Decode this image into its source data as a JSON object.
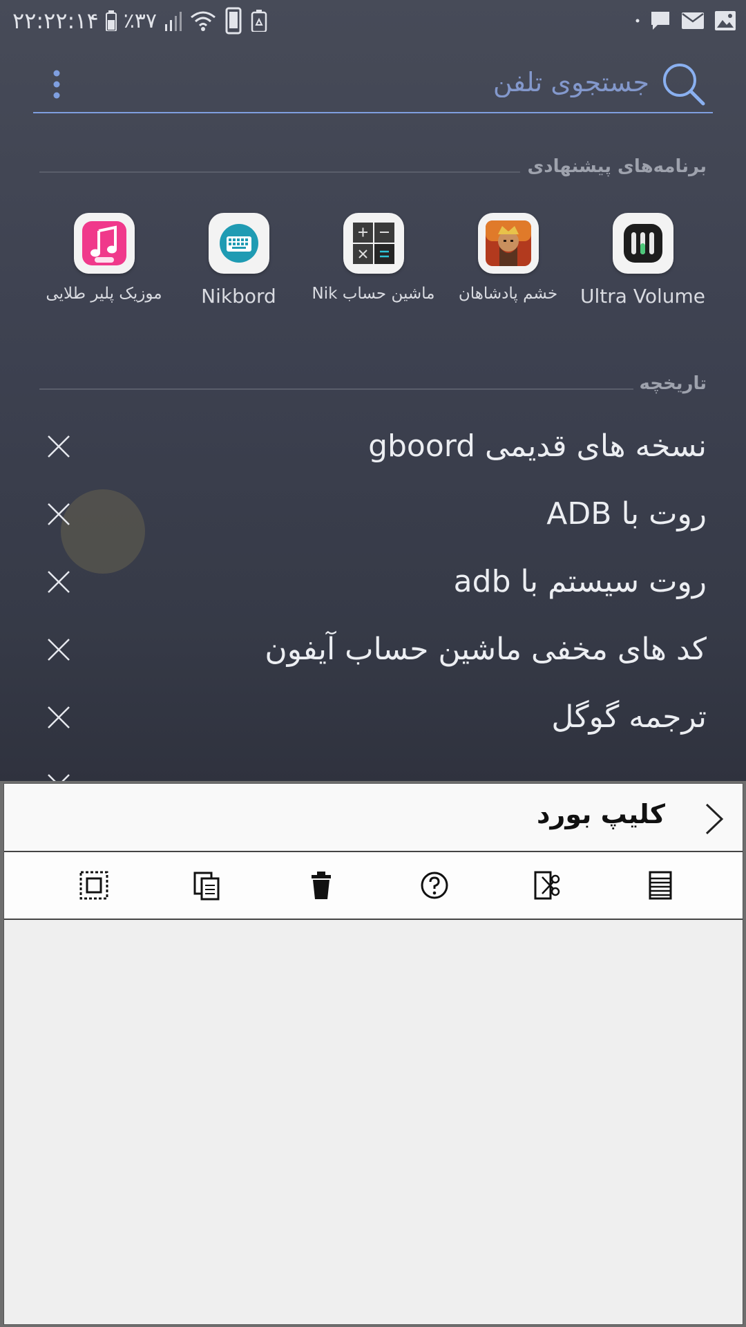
{
  "status_bar": {
    "time": "۲۲:۲۲:۱۴",
    "battery_percent": "٪۳۷",
    "icons": [
      "battery-icon",
      "signal-icon",
      "wifi-icon",
      "phone-icon",
      "recycle-icon",
      "dot-icon",
      "chat-icon",
      "mail-icon",
      "image-icon"
    ]
  },
  "search": {
    "placeholder": "جستجوی تلفن"
  },
  "suggested": {
    "title": "برنامه‌های پیشنهادی",
    "apps": [
      {
        "label": "Ultra Volume",
        "icon": "ultra-volume-icon"
      },
      {
        "label": "خشم پادشاهان",
        "icon": "game-knight-icon"
      },
      {
        "label": "ماشین حساب Nik",
        "icon": "calculator-icon"
      },
      {
        "label": "Nikbord",
        "icon": "keyboard-icon"
      },
      {
        "label": "موزیک پلیر طلایی",
        "icon": "music-player-icon"
      }
    ]
  },
  "history": {
    "title": "تاریخچه",
    "items": [
      {
        "text": "نسخه های قدیمی gboord"
      },
      {
        "text": "روت با ADB"
      },
      {
        "text": "روت سیستم با adb"
      },
      {
        "text": "کد های مخفی ماشین حساب آیفون"
      },
      {
        "text": "ترجمه گوگل"
      }
    ]
  },
  "clipboard": {
    "title": "کلیپ بورد",
    "toolbar": [
      "select-all-icon",
      "copy-icon",
      "delete-icon",
      "help-icon",
      "cut-icon",
      "document-icon"
    ]
  },
  "colors": {
    "accent": "#7f9fe0",
    "background": "#3d4150",
    "panel": "#efefef"
  }
}
